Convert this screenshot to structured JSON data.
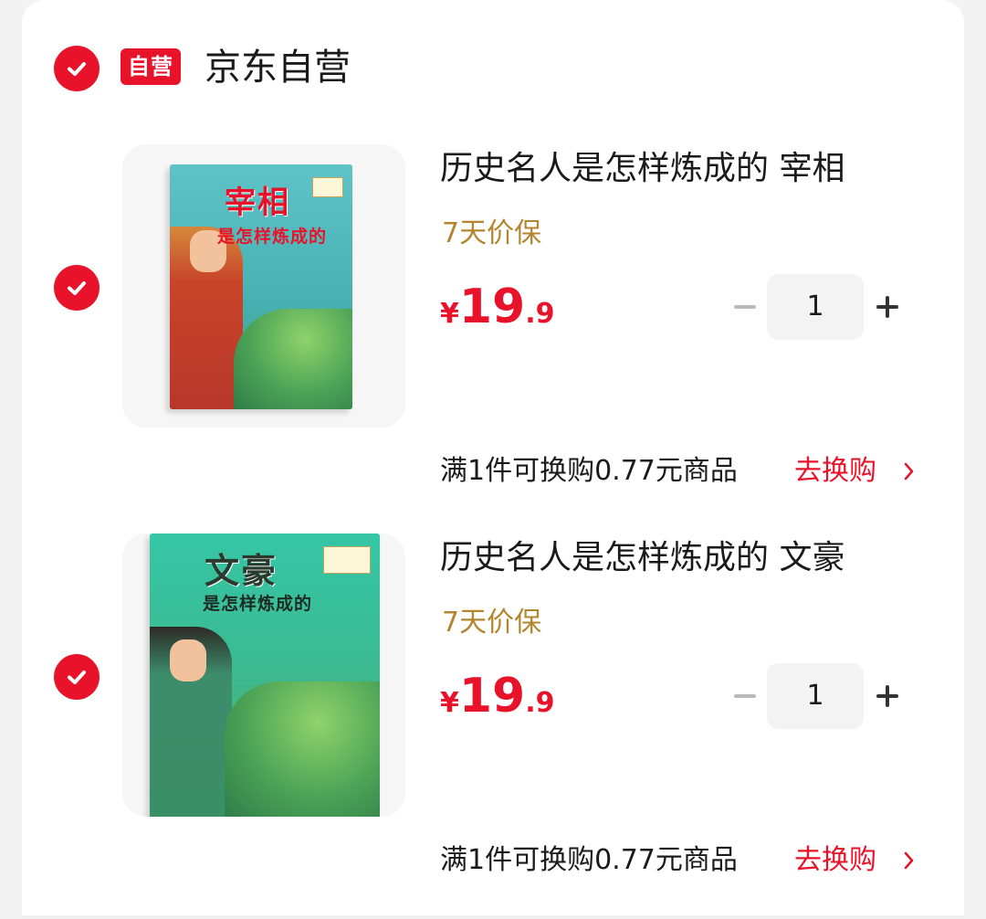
{
  "shop": {
    "badge": "自营",
    "name": "京东自营",
    "selected": true
  },
  "items": [
    {
      "title": "历史名人是怎样炼成的 宰相",
      "tag": "7天价保",
      "price": {
        "currency": "¥",
        "integer": "19",
        "decimal": ".9"
      },
      "quantity": "1",
      "promo": "满1件可换购0.77元商品",
      "promo_link": "去换购",
      "selected": true,
      "cover": {
        "title": "宰相",
        "subtitle": "是怎样炼成的"
      }
    },
    {
      "title": "历史名人是怎样炼成的 文豪",
      "tag": "7天价保",
      "price": {
        "currency": "¥",
        "integer": "19",
        "decimal": ".9"
      },
      "quantity": "1",
      "promo": "满1件可换购0.77元商品",
      "promo_link": "去换购",
      "selected": true,
      "cover": {
        "title": "文豪",
        "subtitle": "是怎样炼成的"
      }
    }
  ],
  "colors": {
    "accent": "#e8132a",
    "tag": "#b3852e",
    "text": "#1a1a1a"
  }
}
